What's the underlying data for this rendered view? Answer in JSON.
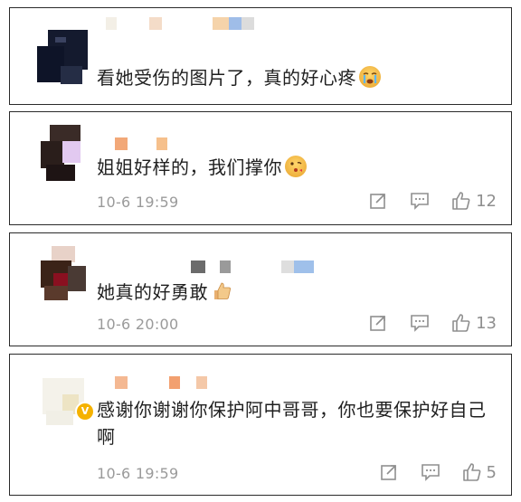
{
  "comments": [
    {
      "text": "看她受伤的图片了，真的好心疼",
      "emoji": "crying-face",
      "time": "",
      "likes": ""
    },
    {
      "text": "姐姐好样的，我们撑你",
      "emoji": "face-blowing-kiss",
      "time": "10-6 19:59",
      "likes": "12"
    },
    {
      "text": "她真的好勇敢",
      "emoji": "thumbs-up",
      "time": "10-6 20:00",
      "likes": "13"
    },
    {
      "text": "感谢你谢谢你保护阿中哥哥，你也要保护好自己啊",
      "emoji": "",
      "time": "10-6 19:59",
      "likes": "5",
      "verified_badge": "V"
    }
  ],
  "icons": {
    "share": "share-icon",
    "comment": "comment-icon",
    "like": "thumbs-up-icon"
  },
  "colors": {
    "meta_text": "#9a9a9a",
    "border": "#2a2a2a",
    "verified": "#f5b200"
  }
}
